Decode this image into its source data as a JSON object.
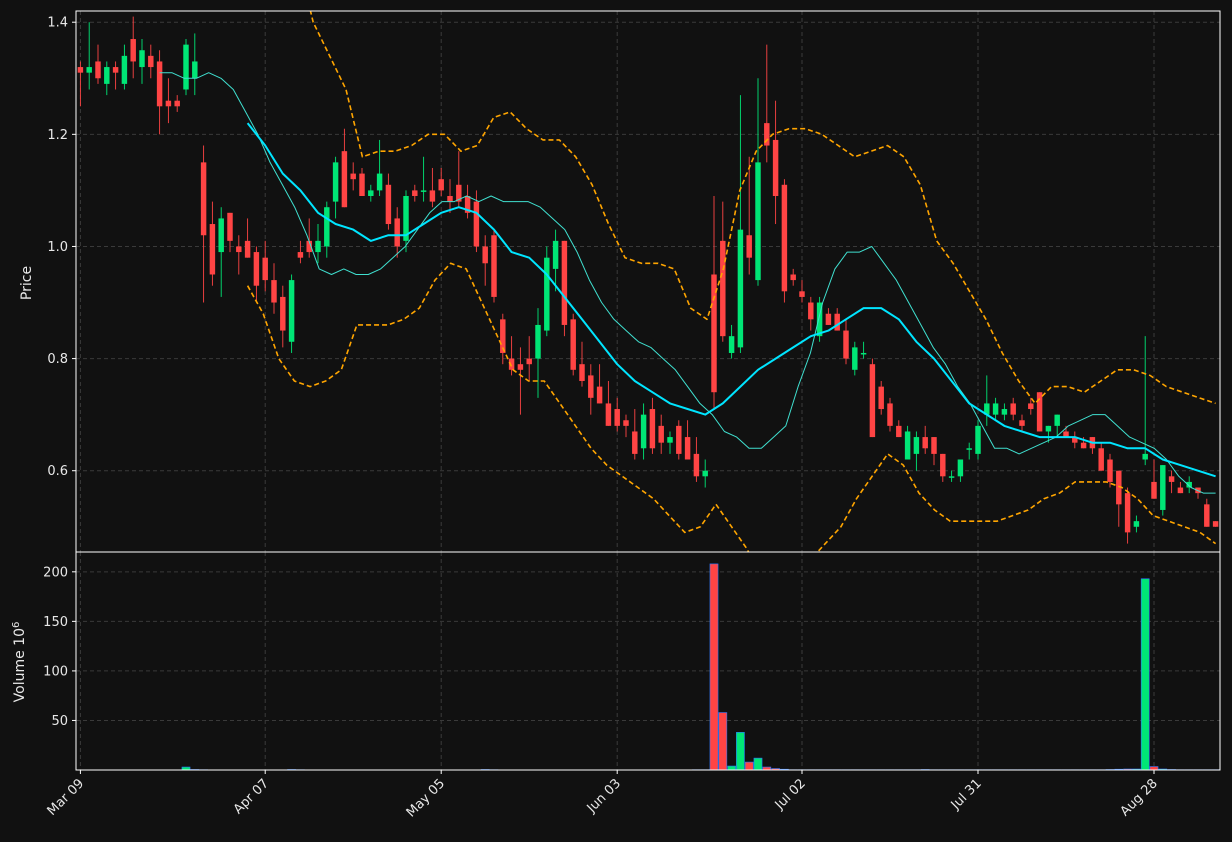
{
  "chart_data": {
    "type": "candlestick",
    "x": [
      "Mar 09",
      "Mar 10",
      "Mar 11",
      "Mar 12",
      "Mar 13",
      "Mar 16",
      "Mar 17",
      "Mar 18",
      "Mar 19",
      "Mar 20",
      "Mar 23",
      "Mar 24",
      "Mar 25",
      "Mar 26",
      "Mar 27",
      "Mar 30",
      "Mar 31",
      "Apr 01",
      "Apr 02",
      "Apr 03",
      "Apr 06",
      "Apr 07",
      "Apr 08",
      "Apr 09",
      "Apr 10",
      "Apr 13",
      "Apr 14",
      "Apr 15",
      "Apr 16",
      "Apr 17",
      "Apr 20",
      "Apr 21",
      "Apr 22",
      "Apr 23",
      "Apr 24",
      "Apr 27",
      "Apr 28",
      "Apr 29",
      "Apr 30",
      "May 01",
      "May 04",
      "May 05",
      "May 06",
      "May 07",
      "May 08",
      "May 11",
      "May 12",
      "May 13",
      "May 14",
      "May 15",
      "May 18",
      "May 19",
      "May 20",
      "May 21",
      "May 22",
      "May 26",
      "May 27",
      "May 28",
      "May 29",
      "Jun 01",
      "Jun 02",
      "Jun 03",
      "Jun 04",
      "Jun 05",
      "Jun 08",
      "Jun 09",
      "Jun 10",
      "Jun 11",
      "Jun 12",
      "Jun 15",
      "Jun 16",
      "Jun 17",
      "Jun 18",
      "Jun 19",
      "Jun 22",
      "Jun 23",
      "Jun 24",
      "Jun 25",
      "Jun 26",
      "Jun 29",
      "Jun 30",
      "Jul 01",
      "Jul 02",
      "Jul 06",
      "Jul 07",
      "Jul 08",
      "Jul 09",
      "Jul 10",
      "Jul 13",
      "Jul 14",
      "Jul 15",
      "Jul 16",
      "Jul 17",
      "Jul 20",
      "Jul 21",
      "Jul 22",
      "Jul 23",
      "Jul 24",
      "Jul 27",
      "Jul 28",
      "Jul 29",
      "Jul 30",
      "Jul 31",
      "Aug 03",
      "Aug 04",
      "Aug 05",
      "Aug 06",
      "Aug 07",
      "Aug 10",
      "Aug 11",
      "Aug 12",
      "Aug 13",
      "Aug 14",
      "Aug 17",
      "Aug 18",
      "Aug 19",
      "Aug 20",
      "Aug 21",
      "Aug 24",
      "Aug 25",
      "Aug 26",
      "Aug 27",
      "Aug 28",
      "Aug 31",
      "Sep 01",
      "Sep 02",
      "Sep 03",
      "Sep 04"
    ],
    "ohlc": [
      [
        1.32,
        1.33,
        1.25,
        1.31
      ],
      [
        1.31,
        1.4,
        1.28,
        1.32
      ],
      [
        1.33,
        1.36,
        1.29,
        1.3
      ],
      [
        1.29,
        1.33,
        1.27,
        1.32
      ],
      [
        1.32,
        1.33,
        1.28,
        1.31
      ],
      [
        1.29,
        1.36,
        1.28,
        1.34
      ],
      [
        1.37,
        1.41,
        1.3,
        1.33
      ],
      [
        1.32,
        1.37,
        1.29,
        1.35
      ],
      [
        1.34,
        1.36,
        1.3,
        1.32
      ],
      [
        1.33,
        1.35,
        1.2,
        1.25
      ],
      [
        1.26,
        1.3,
        1.22,
        1.25
      ],
      [
        1.26,
        1.27,
        1.24,
        1.25
      ],
      [
        1.28,
        1.37,
        1.27,
        1.36
      ],
      [
        1.3,
        1.38,
        1.27,
        1.33
      ],
      [
        1.15,
        1.18,
        0.9,
        1.02
      ],
      [
        1.04,
        1.08,
        0.93,
        0.95
      ],
      [
        0.99,
        1.07,
        0.91,
        1.05
      ],
      [
        1.06,
        1.06,
        0.99,
        1.01
      ],
      [
        1.0,
        1.02,
        0.95,
        0.99
      ],
      [
        1.01,
        1.05,
        0.98,
        0.98
      ],
      [
        0.99,
        1.0,
        0.9,
        0.93
      ],
      [
        0.98,
        1.01,
        0.92,
        0.94
      ],
      [
        0.94,
        0.97,
        0.88,
        0.9
      ],
      [
        0.91,
        0.93,
        0.82,
        0.85
      ],
      [
        0.83,
        0.95,
        0.81,
        0.94
      ],
      [
        0.99,
        1.01,
        0.97,
        0.98
      ],
      [
        1.01,
        1.05,
        0.98,
        0.99
      ],
      [
        0.99,
        1.04,
        0.97,
        1.01
      ],
      [
        1.0,
        1.08,
        0.98,
        1.07
      ],
      [
        1.08,
        1.16,
        1.05,
        1.15
      ],
      [
        1.17,
        1.21,
        1.07,
        1.07
      ],
      [
        1.13,
        1.15,
        1.1,
        1.12
      ],
      [
        1.13,
        1.14,
        1.09,
        1.09
      ],
      [
        1.09,
        1.11,
        1.08,
        1.1
      ],
      [
        1.1,
        1.19,
        1.09,
        1.13
      ],
      [
        1.11,
        1.13,
        1.03,
        1.04
      ],
      [
        1.05,
        1.07,
        0.98,
        1.0
      ],
      [
        1.01,
        1.1,
        0.99,
        1.09
      ],
      [
        1.1,
        1.11,
        1.08,
        1.09
      ],
      [
        1.1,
        1.16,
        1.08,
        1.1
      ],
      [
        1.1,
        1.14,
        1.07,
        1.08
      ],
      [
        1.12,
        1.14,
        1.09,
        1.1
      ],
      [
        1.09,
        1.12,
        1.06,
        1.08
      ],
      [
        1.11,
        1.17,
        1.07,
        1.08
      ],
      [
        1.09,
        1.11,
        1.05,
        1.06
      ],
      [
        1.08,
        1.1,
        0.99,
        1.0
      ],
      [
        1.0,
        1.02,
        0.93,
        0.97
      ],
      [
        1.02,
        1.03,
        0.9,
        0.91
      ],
      [
        0.87,
        0.88,
        0.79,
        0.81
      ],
      [
        0.8,
        0.84,
        0.77,
        0.78
      ],
      [
        0.79,
        0.82,
        0.7,
        0.78
      ],
      [
        0.8,
        0.84,
        0.76,
        0.79
      ],
      [
        0.8,
        0.89,
        0.73,
        0.86
      ],
      [
        0.85,
        1.0,
        0.84,
        0.98
      ],
      [
        0.96,
        1.03,
        0.92,
        1.01
      ],
      [
        1.01,
        1.01,
        0.84,
        0.86
      ],
      [
        0.87,
        0.88,
        0.77,
        0.78
      ],
      [
        0.79,
        0.83,
        0.75,
        0.76
      ],
      [
        0.77,
        0.79,
        0.7,
        0.73
      ],
      [
        0.75,
        0.79,
        0.72,
        0.72
      ],
      [
        0.72,
        0.76,
        0.68,
        0.68
      ],
      [
        0.71,
        0.73,
        0.67,
        0.68
      ],
      [
        0.69,
        0.7,
        0.66,
        0.68
      ],
      [
        0.67,
        0.71,
        0.62,
        0.63
      ],
      [
        0.64,
        0.72,
        0.62,
        0.7
      ],
      [
        0.71,
        0.73,
        0.63,
        0.64
      ],
      [
        0.68,
        0.7,
        0.63,
        0.65
      ],
      [
        0.65,
        0.67,
        0.63,
        0.66
      ],
      [
        0.68,
        0.69,
        0.62,
        0.63
      ],
      [
        0.66,
        0.69,
        0.62,
        0.62
      ],
      [
        0.63,
        0.66,
        0.58,
        0.59
      ],
      [
        0.59,
        0.62,
        0.57,
        0.6
      ],
      [
        0.95,
        1.09,
        0.71,
        0.74
      ],
      [
        1.01,
        1.08,
        0.83,
        0.84
      ],
      [
        0.81,
        0.86,
        0.8,
        0.84
      ],
      [
        0.82,
        1.27,
        0.81,
        1.03
      ],
      [
        1.02,
        1.16,
        0.95,
        0.98
      ],
      [
        0.94,
        1.3,
        0.93,
        1.15
      ],
      [
        1.22,
        1.36,
        1.15,
        1.18
      ],
      [
        1.19,
        1.26,
        1.04,
        1.09
      ],
      [
        1.11,
        1.12,
        0.9,
        0.92
      ],
      [
        0.95,
        0.96,
        0.93,
        0.94
      ],
      [
        0.92,
        0.94,
        0.9,
        0.91
      ],
      [
        0.9,
        0.91,
        0.85,
        0.87
      ],
      [
        0.84,
        0.91,
        0.83,
        0.9
      ],
      [
        0.88,
        0.89,
        0.86,
        0.86
      ],
      [
        0.88,
        0.89,
        0.85,
        0.85
      ],
      [
        0.85,
        0.87,
        0.79,
        0.8
      ],
      [
        0.78,
        0.83,
        0.77,
        0.82
      ],
      [
        0.81,
        0.83,
        0.8,
        0.81
      ],
      [
        0.79,
        0.8,
        0.66,
        0.66
      ],
      [
        0.75,
        0.76,
        0.7,
        0.71
      ],
      [
        0.72,
        0.73,
        0.67,
        0.68
      ],
      [
        0.68,
        0.69,
        0.66,
        0.66
      ],
      [
        0.62,
        0.68,
        0.62,
        0.67
      ],
      [
        0.63,
        0.67,
        0.6,
        0.66
      ],
      [
        0.66,
        0.68,
        0.63,
        0.64
      ],
      [
        0.66,
        0.66,
        0.61,
        0.63
      ],
      [
        0.63,
        0.63,
        0.58,
        0.59
      ],
      [
        0.59,
        0.6,
        0.58,
        0.59
      ],
      [
        0.59,
        0.62,
        0.58,
        0.62
      ],
      [
        0.64,
        0.65,
        0.62,
        0.64
      ],
      [
        0.63,
        0.69,
        0.62,
        0.68
      ],
      [
        0.7,
        0.77,
        0.68,
        0.72
      ],
      [
        0.7,
        0.73,
        0.69,
        0.72
      ],
      [
        0.7,
        0.72,
        0.69,
        0.71
      ],
      [
        0.72,
        0.73,
        0.69,
        0.7
      ],
      [
        0.69,
        0.7,
        0.67,
        0.68
      ],
      [
        0.72,
        0.73,
        0.7,
        0.71
      ],
      [
        0.74,
        0.74,
        0.67,
        0.67
      ],
      [
        0.67,
        0.68,
        0.65,
        0.68
      ],
      [
        0.68,
        0.7,
        0.66,
        0.7
      ],
      [
        0.67,
        0.68,
        0.66,
        0.66
      ],
      [
        0.66,
        0.67,
        0.64,
        0.65
      ],
      [
        0.65,
        0.66,
        0.64,
        0.64
      ],
      [
        0.66,
        0.66,
        0.63,
        0.64
      ],
      [
        0.64,
        0.65,
        0.61,
        0.6
      ],
      [
        0.62,
        0.63,
        0.57,
        0.58
      ],
      [
        0.6,
        0.6,
        0.5,
        0.54
      ],
      [
        0.56,
        0.57,
        0.47,
        0.49
      ],
      [
        0.5,
        0.52,
        0.49,
        0.51
      ],
      [
        0.62,
        0.84,
        0.61,
        0.63
      ],
      [
        0.58,
        0.62,
        0.55,
        0.55
      ],
      [
        0.53,
        0.61,
        0.52,
        0.61
      ],
      [
        0.59,
        0.6,
        0.56,
        0.58
      ],
      [
        0.57,
        0.58,
        0.56,
        0.56
      ],
      [
        0.57,
        0.59,
        0.56,
        0.58
      ],
      [
        0.57,
        0.57,
        0.55,
        0.56
      ],
      [
        0.54,
        0.55,
        0.5,
        0.5
      ],
      [
        0.51,
        0.51,
        0.5,
        0.5
      ]
    ],
    "volume": [
      0.05,
      0.05,
      0.05,
      0.05,
      0.05,
      0.05,
      0.05,
      0.05,
      0.05,
      0.05,
      0.05,
      0.05,
      3,
      0.5,
      0.3,
      0.2,
      0.2,
      0.2,
      0.2,
      0.2,
      0.2,
      0.2,
      0.2,
      0.2,
      0.5,
      0.3,
      0.2,
      0.2,
      0.2,
      0.2,
      0.2,
      0.2,
      0.2,
      0.2,
      0.2,
      0.2,
      0.2,
      0.2,
      0.2,
      0.2,
      0.2,
      0.2,
      0.2,
      0.2,
      0.2,
      0.2,
      0.5,
      0.3,
      0.2,
      0.2,
      0.2,
      0.2,
      0.2,
      0.2,
      0.2,
      0.2,
      0.2,
      0.2,
      0.2,
      0.2,
      0.2,
      0.2,
      0.2,
      0.2,
      0.2,
      0.2,
      0.2,
      0.2,
      0.2,
      0.2,
      0.3,
      0.3,
      208,
      58,
      4,
      38,
      8,
      12,
      3,
      1.5,
      0.8,
      0.3,
      0.3,
      0.3,
      0.3,
      0.3,
      0.3,
      0.3,
      0.3,
      0.3,
      0.3,
      0.3,
      0.3,
      0.3,
      0.3,
      0.3,
      0.5,
      0.3,
      0.3,
      0.3,
      0.3,
      0.3,
      0.3,
      0.3,
      0.3,
      0.3,
      0.3,
      0.3,
      0.3,
      0.3,
      0.3,
      0.3,
      0.3,
      0.3,
      0.3,
      0.3,
      0.3,
      0.5,
      0.8,
      1,
      1,
      193,
      3.5,
      1,
      0.5,
      0.3,
      0.3,
      0.3,
      0.3,
      0.3
    ],
    "moving_averages": {
      "fast": [
        1.31,
        1.31,
        1.3,
        1.3,
        1.31,
        1.3,
        1.28,
        1.24,
        1.2,
        1.15,
        1.11,
        1.07,
        1.02,
        0.96,
        0.95,
        0.96,
        0.95,
        0.95,
        0.96,
        0.98,
        1.0,
        1.03,
        1.06,
        1.08,
        1.08,
        1.09,
        1.08,
        1.09,
        1.08,
        1.08,
        1.08,
        1.07,
        1.05,
        1.03,
        0.99,
        0.94,
        0.9,
        0.87,
        0.85,
        0.83,
        0.82,
        0.8,
        0.78,
        0.75,
        0.72,
        0.7,
        0.67,
        0.66,
        0.64,
        0.64,
        0.66,
        0.68,
        0.75,
        0.81,
        0.9,
        0.96,
        0.99,
        0.99,
        1.0,
        0.97,
        0.94,
        0.9,
        0.86,
        0.82,
        0.79,
        0.75,
        0.72,
        0.68,
        0.64,
        0.64,
        0.63,
        0.64,
        0.65,
        0.66,
        0.68,
        0.69,
        0.7,
        0.7,
        0.68,
        0.66,
        0.65,
        0.64,
        0.62,
        0.59,
        0.57,
        0.56,
        0.56
      ],
      "slow": [
        1.22,
        1.18,
        1.13,
        1.1,
        1.06,
        1.04,
        1.03,
        1.01,
        1.02,
        1.02,
        1.04,
        1.06,
        1.07,
        1.06,
        1.03,
        0.99,
        0.98,
        0.95,
        0.91,
        0.87,
        0.83,
        0.79,
        0.76,
        0.74,
        0.72,
        0.71,
        0.7,
        0.72,
        0.75,
        0.78,
        0.8,
        0.82,
        0.84,
        0.85,
        0.87,
        0.89,
        0.89,
        0.87,
        0.83,
        0.8,
        0.76,
        0.72,
        0.7,
        0.68,
        0.67,
        0.66,
        0.66,
        0.66,
        0.65,
        0.65,
        0.64,
        0.64,
        0.62,
        0.61,
        0.6,
        0.59
      ],
      "bollinger_upper": [
        1.82,
        1.75,
        1.65,
        1.52,
        1.4,
        1.34,
        1.28,
        1.16,
        1.17,
        1.17,
        1.18,
        1.2,
        1.2,
        1.17,
        1.18,
        1.23,
        1.24,
        1.21,
        1.19,
        1.19,
        1.16,
        1.11,
        1.04,
        0.98,
        0.97,
        0.97,
        0.96,
        0.89,
        0.87,
        0.96,
        1.1,
        1.17,
        1.2,
        1.21,
        1.21,
        1.2,
        1.18,
        1.16,
        1.17,
        1.18,
        1.16,
        1.11,
        1.01,
        0.97,
        0.92,
        0.87,
        0.81,
        0.76,
        0.72,
        0.75,
        0.75,
        0.74,
        0.76,
        0.78,
        0.78,
        0.77,
        0.75,
        0.74,
        0.73,
        0.72
      ],
      "bollinger_lower": [
        0.93,
        0.88,
        0.8,
        0.76,
        0.75,
        0.76,
        0.78,
        0.86,
        0.86,
        0.86,
        0.87,
        0.89,
        0.94,
        0.97,
        0.96,
        0.9,
        0.84,
        0.78,
        0.76,
        0.76,
        0.72,
        0.68,
        0.64,
        0.61,
        0.59,
        0.57,
        0.55,
        0.52,
        0.49,
        0.5,
        0.54,
        0.5,
        0.46,
        0.4,
        0.4,
        0.41,
        0.44,
        0.47,
        0.5,
        0.55,
        0.59,
        0.63,
        0.61,
        0.56,
        0.53,
        0.51,
        0.51,
        0.51,
        0.51,
        0.52,
        0.53,
        0.55,
        0.56,
        0.58,
        0.58,
        0.58,
        0.57,
        0.55,
        0.52,
        0.51,
        0.5,
        0.49,
        0.47
      ]
    },
    "ylabel": "Price",
    "volume_ylabel": "Volume  10",
    "volume_exponent": "6",
    "ylim": [
      0.455,
      1.42
    ],
    "volume_ylim": [
      0,
      220
    ],
    "yticks": [
      "0.6",
      "0.8",
      "1.0",
      "1.2",
      "1.4"
    ],
    "volume_yticks": [
      "50",
      "100",
      "150",
      "200"
    ],
    "xtick_labels": [
      "Mar 09",
      "Apr 07",
      "May 05",
      "Jun 03",
      "Jul 02",
      "Jul 31",
      "Aug 28"
    ],
    "grid": true,
    "colors": {
      "background": "#111111",
      "up": "#00e676",
      "down": "#ff4444",
      "wick_up": "#00e676",
      "wick_down": "#ff4444",
      "ma_fast": "#40e0d0",
      "ma_slow": "#00e5ff",
      "bollinger": "#ffa500",
      "grid": "#3a3a3a",
      "axis": "#ffffff",
      "volume_edge": "#2979ff"
    }
  }
}
